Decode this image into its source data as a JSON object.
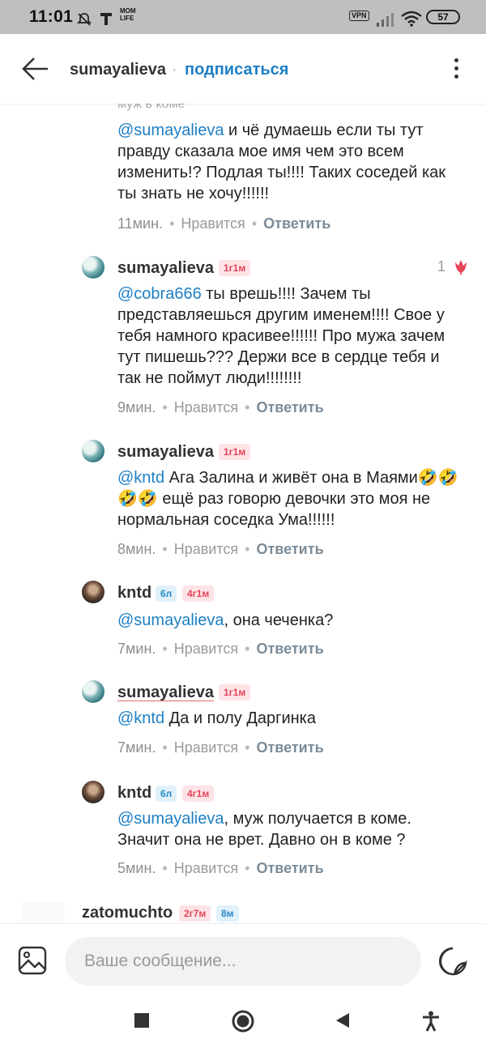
{
  "status_bar": {
    "time": "11:01",
    "operator_badge": "MOM\nLIFE",
    "vpn": "VPN",
    "battery": "57",
    "icons": [
      "mute-icon",
      "t-icon",
      "signal-icon",
      "wifi-icon"
    ]
  },
  "header": {
    "username": "sumayalieva",
    "separator": "·",
    "follow_label": "подписаться",
    "follow_color": "#1d7fc4"
  },
  "feed": {
    "partial_text": "муж в коме",
    "comments": [
      {
        "mention": "@sumayalieva",
        "text": " и чё думаешь если ты тут правду сказала  мое  имя  чем это всем изменить!?  Подлая ты!!!! Таких соседей как ты знать не хочу!!!!!!",
        "time": "11мин.",
        "like_label": "Нравится",
        "reply_label": "Ответить"
      },
      {
        "author": "sumayalieva",
        "badge": "1г1м",
        "likes": "1",
        "mention": "@cobra666",
        "text": "  ты врешь!!!! Зачем ты представляешься другим именем!!!!  Свое у тебя намного красивее!!!!!!  Про мужа зачем тут пишешь??? Держи все в сердце тебя и так не поймут люди!!!!!!!!",
        "time": "9мин.",
        "like_label": "Нравится",
        "reply_label": "Ответить"
      },
      {
        "author": "sumayalieva",
        "badge": "1г1м",
        "mention": "@kntd",
        "text": " Ага Залина и живёт она в Маями🤣🤣🤣🤣 ещё раз говорю девочки это моя не нормальная соседка Ума!!!!!!",
        "time": "8мин.",
        "like_label": "Нравится",
        "reply_label": "Ответить"
      },
      {
        "author": "kntd",
        "badge_blue": "6л",
        "badge": "4г1м",
        "mention": "@sumayalieva",
        "text": ", она чеченка?",
        "time": "7мин.",
        "like_label": "Нравится",
        "reply_label": "Ответить"
      },
      {
        "author": "sumayalieva",
        "badge": "1г1м",
        "mention": "@kntd",
        "text": " Да и полу Даргинка",
        "time": "7мин.",
        "like_label": "Нравится",
        "reply_label": "Ответить"
      },
      {
        "author": "kntd",
        "badge_blue": "6л",
        "badge": "4г1м",
        "mention": "@sumayalieva",
        "text": ", муж получается в коме. Значит она не врет. Давно он в коме ?",
        "time": "5мин.",
        "like_label": "Нравится",
        "reply_label": "Ответить"
      },
      {
        "author": "zatomuchto",
        "badge": "2г7м",
        "badge_blue": "8м"
      }
    ]
  },
  "composer": {
    "placeholder": "Ваше сообщение..."
  },
  "colors": {
    "mention": "#1d7fc4",
    "badge_pink_bg": "#fde3e6",
    "badge_pink_text": "#e2435a",
    "badge_blue_bg": "#e0f1fb",
    "badge_blue_text": "#2a8bc5"
  }
}
